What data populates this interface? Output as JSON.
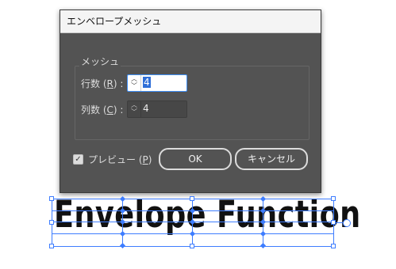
{
  "dialog": {
    "title": "エンベロープメッシュ",
    "group_label": "メッシュ",
    "rows_label_prefix": "行数 (",
    "rows_label_key": "R",
    "rows_label_suffix": ") :",
    "rows_value": "4",
    "cols_label_prefix": "列数 (",
    "cols_label_key": "C",
    "cols_label_suffix": ") :",
    "cols_value": "4",
    "preview_label_prefix": "プレビュー (",
    "preview_label_key": "P",
    "preview_label_suffix": ")",
    "preview_checked": true,
    "ok_label": "OK",
    "cancel_label": "キャンセル"
  },
  "artwork": {
    "text": "Envelope Function"
  },
  "colors": {
    "dialog_bg": "#535353",
    "selection": "#3e7dff",
    "focus": "#3e8ef7"
  }
}
